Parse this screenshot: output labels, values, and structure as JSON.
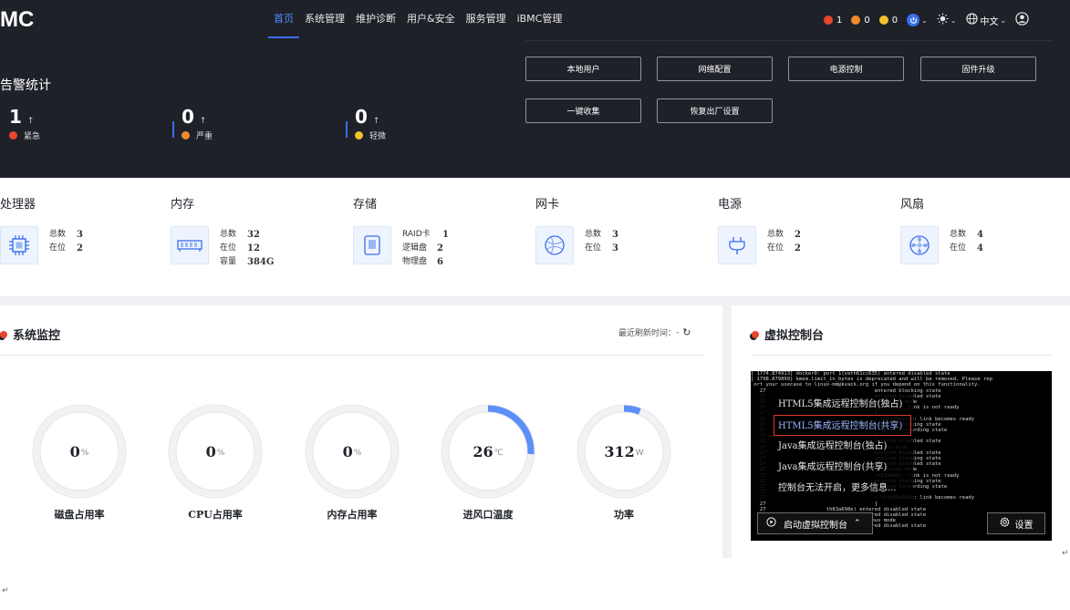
{
  "header": {
    "logo": "MC",
    "nav": [
      "首页",
      "系统管理",
      "维护诊断",
      "用户&安全",
      "服务管理",
      "iBMC管理"
    ],
    "alarms": {
      "critical": "1",
      "major": "0",
      "minor": "0"
    },
    "language": "中文"
  },
  "alarm_stats": {
    "title": "告警统计",
    "items": [
      {
        "count": "1",
        "arrow": "↑",
        "label": "紧急"
      },
      {
        "count": "0",
        "arrow": "↑",
        "label": "严重"
      },
      {
        "count": "0",
        "arrow": "↑",
        "label": "轻微"
      }
    ]
  },
  "quick_actions": [
    "本地用户",
    "网络配置",
    "电源控制",
    "固件升级",
    "一键收集",
    "恢复出厂设置"
  ],
  "hardware": [
    {
      "title": "处理器",
      "icon": "cpu-icon",
      "rows": [
        {
          "k": "总数",
          "v": "3"
        },
        {
          "k": "在位",
          "v": "2"
        }
      ]
    },
    {
      "title": "内存",
      "icon": "memory-icon",
      "rows": [
        {
          "k": "总数",
          "v": "32"
        },
        {
          "k": "在位",
          "v": "12"
        },
        {
          "k": "容量",
          "v": "384G"
        }
      ]
    },
    {
      "title": "存储",
      "icon": "storage-icon",
      "rows": [
        {
          "k": "RAID卡",
          "v": "1"
        },
        {
          "k": "逻辑盘",
          "v": "2"
        },
        {
          "k": "物理盘",
          "v": "6"
        }
      ]
    },
    {
      "title": "网卡",
      "icon": "network-card-icon",
      "rows": [
        {
          "k": "总数",
          "v": "3"
        },
        {
          "k": "在位",
          "v": "3"
        }
      ]
    },
    {
      "title": "电源",
      "icon": "power-supply-icon",
      "rows": [
        {
          "k": "总数",
          "v": "2"
        },
        {
          "k": "在位",
          "v": "2"
        }
      ]
    },
    {
      "title": "风扇",
      "icon": "fan-icon",
      "rows": [
        {
          "k": "总数",
          "v": "4"
        },
        {
          "k": "在位",
          "v": "4"
        }
      ]
    }
  ],
  "monitor": {
    "title": "系统监控",
    "refresh_label": "最近刷新时间：",
    "refresh_value": "-",
    "gauges": [
      {
        "label": "磁盘占用率",
        "value": "0",
        "unit": "%",
        "fraction": 0
      },
      {
        "label": "CPU占用率",
        "value": "0",
        "unit": "%",
        "fraction": 0
      },
      {
        "label": "内存占用率",
        "value": "0",
        "unit": "%",
        "fraction": 0
      },
      {
        "label": "进风口温度",
        "value": "26",
        "unit": "℃",
        "fraction": 0.26
      },
      {
        "label": "功率",
        "value": "312",
        "unit": "W",
        "fraction": 0.06
      }
    ]
  },
  "console": {
    "title": "虚拟控制台",
    "menu": [
      "HTML5集成远程控制台(独占)",
      "HTML5集成远程控制台(共享)",
      "Java集成远程控制台(独占)",
      "Java集成远程控制台(共享)",
      "控制台无法开启，更多信息..."
    ],
    "launch_label": "启动虚拟控制台",
    "settings_label": "设置"
  },
  "colors": {
    "accent": "#3a6df0",
    "gauge_fill": "#5b8ff9",
    "critical": "#e8452f",
    "major": "#f08b2c",
    "minor": "#f2c12e"
  }
}
